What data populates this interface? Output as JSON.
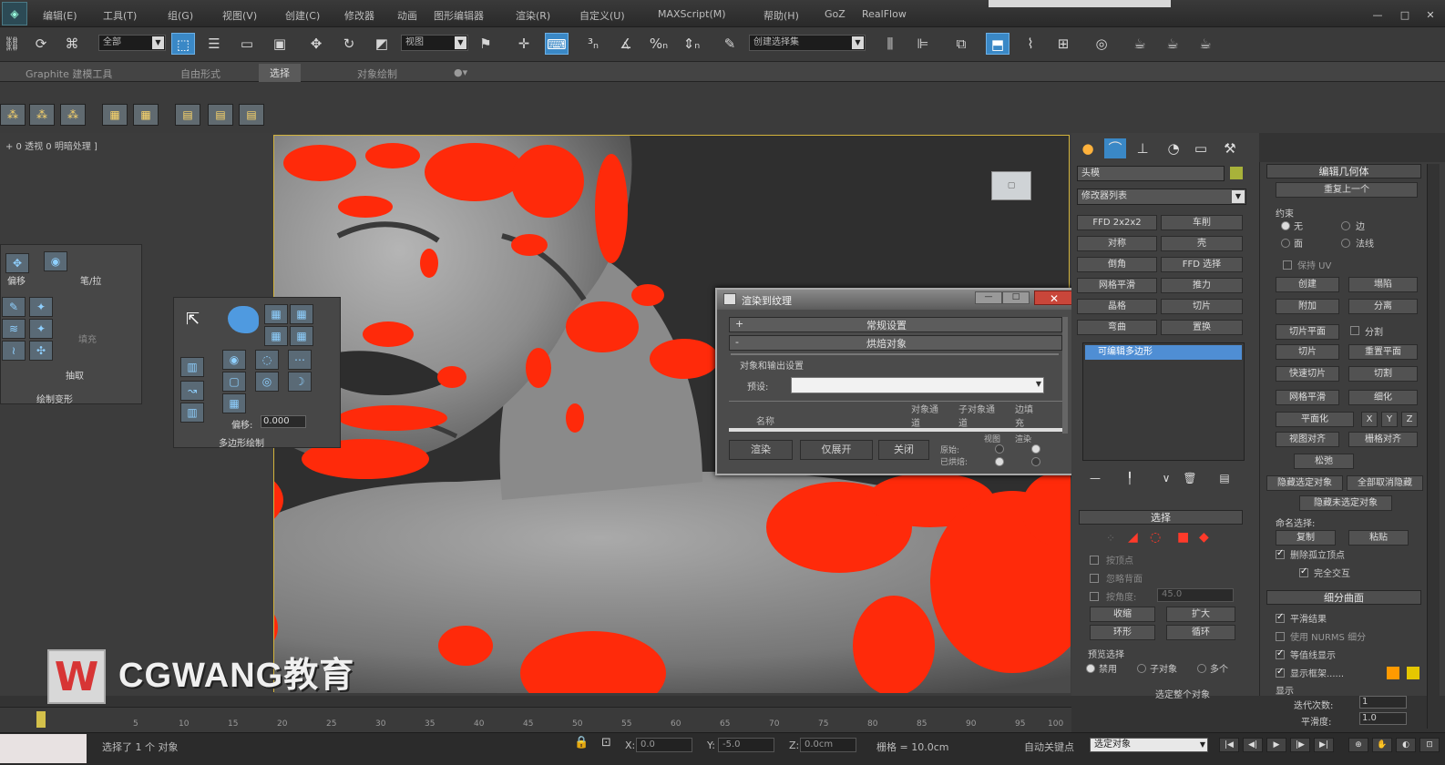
{
  "menu": [
    "编辑(E)",
    "工具(T)",
    "组(G)",
    "视图(V)",
    "创建(C)",
    "修改器",
    "动画",
    "图形编辑器",
    "渲染(R)",
    "自定义(U)",
    "MAXScript(M)",
    "帮助(H)",
    "GoZ",
    "RealFlow"
  ],
  "toolbar": {
    "filter_select": "全部",
    "coord_select": "视图",
    "named_sel": "创建选择集"
  },
  "ribbon": {
    "tabs": [
      "Graphite 建模工具",
      "自由形式",
      "选择",
      "对象绘制"
    ],
    "active_tab": "选择"
  },
  "viewport": {
    "label": "+ 0 透视 0 明暗处理 ]",
    "watermark": "CGWANG教育",
    "watermark_mark": "W"
  },
  "paint_panel": {
    "btn1": "偏移",
    "btn2": "笔/拉",
    "label_fill": "填充",
    "label_extract": "抽取",
    "title": "绘制变形"
  },
  "poly_panel": {
    "offset_label": "偏移:",
    "offset_value": "0.000",
    "title": "多边形绘制"
  },
  "dialog": {
    "title": "渲染到纹理",
    "row1": "常规设置",
    "row2": "烘焙对象",
    "group_label": "对象和输出设置",
    "preset_label": "预设:",
    "col_name": "名称",
    "col_obj": "对象通道",
    "col_sub": "子对象通道",
    "col_edge": "边填充",
    "btn_render": "渲染",
    "btn_unwrap": "仅展开",
    "btn_close": "关闭",
    "orig_label": "原始:",
    "baked_label": "已烘焙:",
    "view_label": "视图",
    "render_label": "渲染"
  },
  "command_panel": {
    "object_name": "头模",
    "modifier_list": "修改器列表",
    "buttons": [
      "FFD 2x2x2",
      "车削",
      "对称",
      "壳",
      "倒角",
      "FFD 选择",
      "网格平滑",
      "推力",
      "晶格",
      "切片",
      "弯曲",
      "置换"
    ],
    "stack_item": "可编辑多边形",
    "selection_title": "选择",
    "by_vertex": "按顶点",
    "ignore_back": "忽略背面",
    "by_angle": "按角度:",
    "angle_value": "45.0",
    "shrink": "收缩",
    "grow": "扩大",
    "ring": "环形",
    "loop": "循环",
    "preview_label": "预览选择",
    "preview_off": "禁用",
    "preview_sub": "子对象",
    "preview_multi": "多个",
    "selected_count": "选定整个对象"
  },
  "edit_panel": {
    "title": "编辑几何体",
    "repeat": "重复上一个",
    "constraint_label": "约束",
    "c_none": "无",
    "c_edge": "边",
    "c_face": "面",
    "c_normal": "法线",
    "keep_uv": "保持 UV",
    "create": "创建",
    "collapse": "塌陷",
    "attach": "附加",
    "detach": "分离",
    "slice_plane": "切片平面",
    "split": "分割",
    "slice": "切片",
    "reset_plane": "重置平面",
    "quickslice": "快速切片",
    "cut": "切割",
    "msmooth": "网格平滑",
    "tessellate": "细化",
    "planarize": "平面化",
    "x": "X",
    "y": "Y",
    "z": "Z",
    "view_align": "视图对齐",
    "grid_align": "栅格对齐",
    "relax": "松弛",
    "hide_sel": "隐藏选定对象",
    "unhide_all": "全部取消隐藏",
    "hide_unsel": "隐藏未选定对象",
    "named_sel": "命名选择:",
    "copy": "复制",
    "paste": "粘贴",
    "del_iso": "删除孤立顶点",
    "full_interact": "完全交互",
    "subdiv_title": "细分曲面",
    "smooth_result": "平滑结果",
    "use_nurms": "使用 NURMS 细分",
    "iso_display": "等值线显示",
    "show_cage": "显示框架......",
    "display_label": "显示",
    "iterations": "迭代次数:",
    "iter_value": "1",
    "smoothness": "平滑度:",
    "smooth_value": "1.0"
  },
  "timeline": {
    "ticks": [
      "5",
      "10",
      "15",
      "20",
      "25",
      "30",
      "35",
      "40",
      "45",
      "50",
      "55",
      "60",
      "65",
      "70",
      "75",
      "80",
      "85",
      "90",
      "95",
      "100"
    ]
  },
  "status": {
    "selected": "选择了 1 个 对象",
    "x_label": "X:",
    "x_value": "0.0",
    "y_label": "Y:",
    "y_value": "-5.0",
    "z_label": "Z:",
    "z_value": "0.0cm",
    "grid": "栅格 = 10.0cm",
    "autokey": "自动关键点",
    "key_filter": "选定对象"
  },
  "colors": {
    "accent": "#3a88c6",
    "paint_red": "#ff2a0a",
    "selection_blue": "#4f8ed4"
  }
}
